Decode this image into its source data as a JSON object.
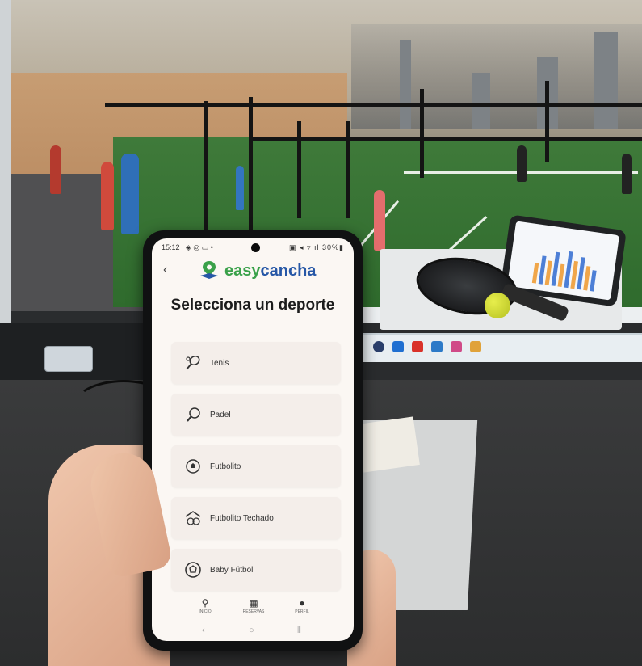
{
  "status_bar": {
    "time": "15:12",
    "left_icons": "◈ ◎ ▭ •",
    "right_icons": "▣ ◂ ▿ ıl 30%▮"
  },
  "app": {
    "logo_easy": "easy",
    "logo_cancha": "cancha",
    "title": "Selecciona un deporte"
  },
  "sports": [
    {
      "label": "Tenis",
      "icon": "tennis-racket-icon"
    },
    {
      "label": "Padel",
      "icon": "padel-racket-icon"
    },
    {
      "label": "Futbolito",
      "icon": "soccer-ball-icon"
    },
    {
      "label": "Futbolito Techado",
      "icon": "indoor-soccer-icon"
    },
    {
      "label": "Baby Fútbol",
      "icon": "baby-soccer-ball-icon"
    }
  ],
  "bottom_nav": [
    {
      "label": "INICIO",
      "icon": "location-pin-icon"
    },
    {
      "label": "RESERVAS",
      "icon": "calendar-icon"
    },
    {
      "label": "PERFIL",
      "icon": "person-icon"
    }
  ],
  "colors": {
    "brand_green": "#3aa14a",
    "brand_blue": "#2657a6",
    "screen_bg": "#fbf7f3",
    "card_bg": "#f4eeea"
  }
}
